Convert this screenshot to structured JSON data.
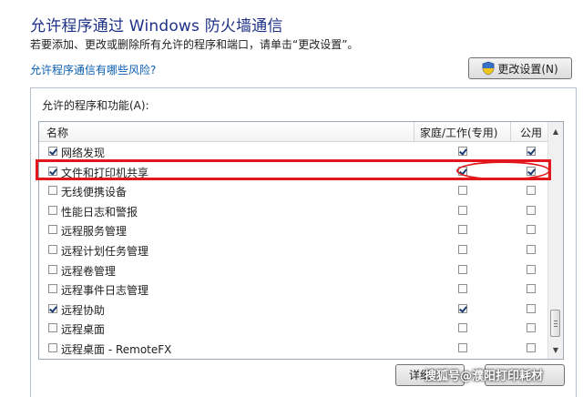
{
  "header": {
    "title": "允许程序通过 Windows 防火墙通信",
    "description": "若要添加、更改或删除所有允许的程序和端口，请单击“更改设置”。",
    "risk_link": "允许程序通信有哪些风险?",
    "change_settings_label": "更改设置(N)"
  },
  "group": {
    "label": "允许的程序和功能(A):",
    "columns": {
      "name": "名称",
      "home": "家庭/工作(专用)",
      "public": "公用"
    },
    "rows": [
      {
        "label": "网络发现",
        "enabled": true,
        "home": true,
        "public": true
      },
      {
        "label": "文件和打印机共享",
        "enabled": true,
        "home": true,
        "public": true
      },
      {
        "label": "无线便携设备",
        "enabled": false,
        "home": false,
        "public": false
      },
      {
        "label": "性能日志和警报",
        "enabled": false,
        "home": false,
        "public": false
      },
      {
        "label": "远程服务管理",
        "enabled": false,
        "home": false,
        "public": false
      },
      {
        "label": "远程计划任务管理",
        "enabled": false,
        "home": false,
        "public": false
      },
      {
        "label": "远程卷管理",
        "enabled": false,
        "home": false,
        "public": false
      },
      {
        "label": "远程事件日志管理",
        "enabled": false,
        "home": false,
        "public": false
      },
      {
        "label": "远程协助",
        "enabled": true,
        "home": true,
        "public": false
      },
      {
        "label": "远程桌面",
        "enabled": false,
        "home": false,
        "public": false
      },
      {
        "label": "远程桌面 - RemoteFX",
        "enabled": false,
        "home": false,
        "public": false
      }
    ]
  },
  "footer": {
    "details_label": "详细",
    "watermark": "搜狐号@濮阳打印耗材"
  },
  "colors": {
    "title": "#1e3287",
    "link": "#0b5db0",
    "highlight": "#e3161b"
  }
}
